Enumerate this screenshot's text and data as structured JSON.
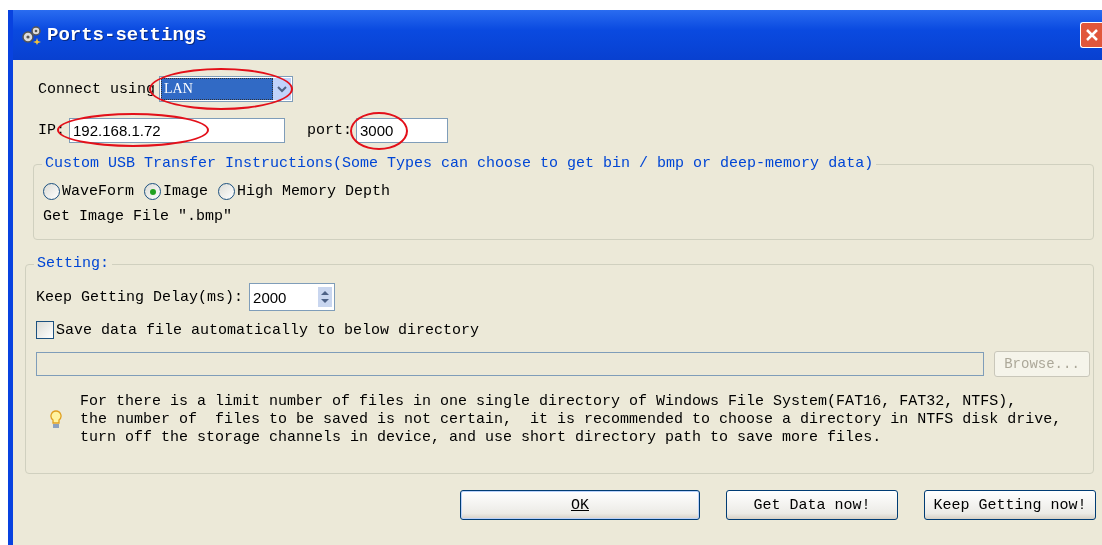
{
  "window": {
    "title": "Ports-settings"
  },
  "connect": {
    "label": "Connect using",
    "value": "LAN",
    "annotated": true
  },
  "ip": {
    "label": "IP:",
    "value": "192.168.1.72",
    "annotated": true
  },
  "port": {
    "label": "port:",
    "value": "3000",
    "annotated": true
  },
  "transfer": {
    "title": "Custom USB Transfer Instructions(Some Types can choose to get bin / bmp or deep-memory data)",
    "options": [
      {
        "label": "WaveForm",
        "selected": false
      },
      {
        "label": "Image",
        "selected": true
      },
      {
        "label": "High Memory Depth",
        "selected": false
      }
    ],
    "hint": "Get Image File \".bmp\""
  },
  "setting": {
    "title": "Setting:",
    "delay_label": "Keep Getting Delay(ms):",
    "delay_value": "2000",
    "autosave": {
      "label": "Save data file automatically to below directory",
      "checked": false
    },
    "browse": {
      "label": "Browse...",
      "disabled": true
    },
    "note_lines": [
      "For there is a limit number of files in one single directory of Windows File System(FAT16, FAT32, NTFS),",
      "the number of  files to be saved is not certain,  it is recommended to choose a directory in NTFS disk drive,",
      "turn off the storage channels in device, and use short directory path to save more files."
    ]
  },
  "buttons": [
    {
      "label": "OK",
      "kind": "default"
    },
    {
      "label": "Get Data now!",
      "kind": "normal"
    },
    {
      "label": "Keep Getting now!",
      "kind": "normal"
    }
  ]
}
